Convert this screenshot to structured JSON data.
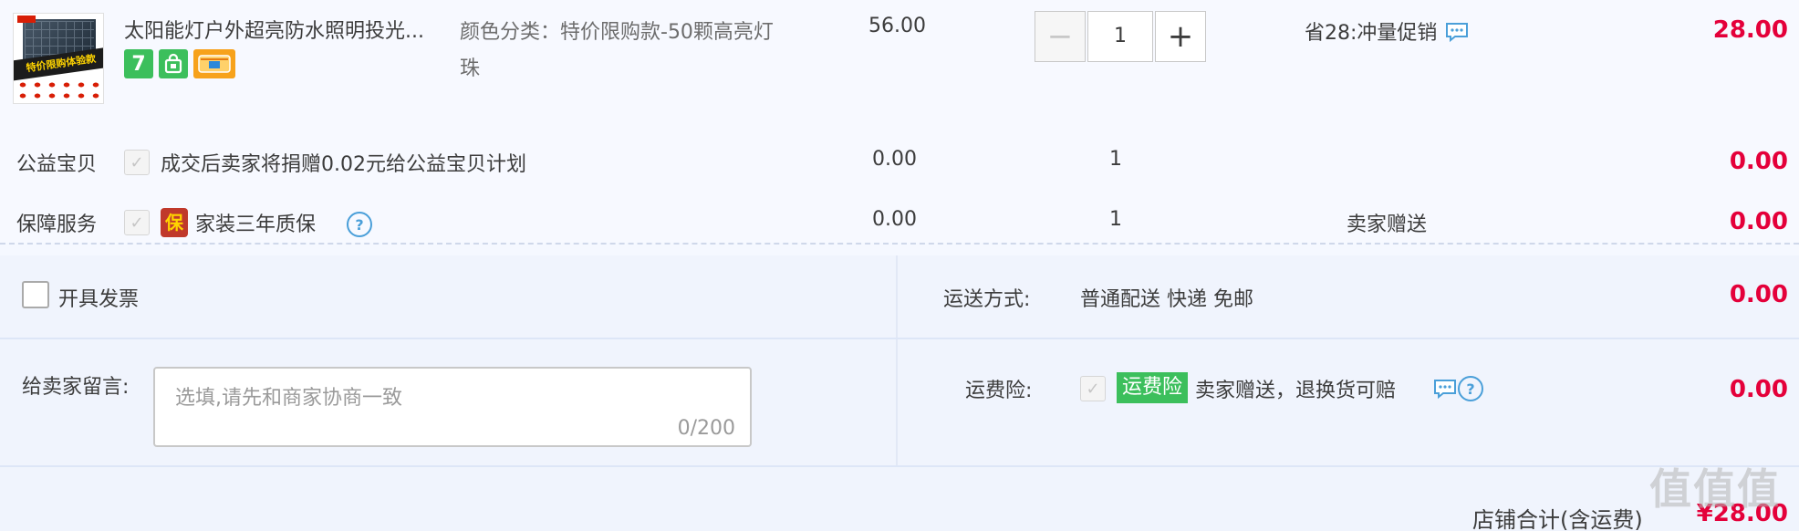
{
  "product": {
    "title": "太阳能灯户外超亮防水照明投光...",
    "image_banner": "特价限购体验款",
    "badge_7": "7",
    "sku": "颜色分类：特价限购款-50颗高亮灯珠",
    "unit_price": "56.00",
    "quantity": "1",
    "minus_label": "−",
    "plus_label": "+",
    "promo": "省28:冲量促销",
    "subtotal": "28.00"
  },
  "charity": {
    "label": "公益宝贝",
    "desc": "成交后卖家将捐赠0.02元给公益宝贝计划",
    "price": "0.00",
    "qty": "1",
    "total": "0.00"
  },
  "service": {
    "label": "保障服务",
    "badge": "保",
    "desc": "家装三年质保",
    "help": "?",
    "price": "0.00",
    "qty": "1",
    "gift": "卖家赠送",
    "total": "0.00"
  },
  "invoice": {
    "label": "开具发票"
  },
  "shipping": {
    "label": "运送方式:",
    "value": "普通配送 快递 免邮",
    "total": "0.00"
  },
  "memo": {
    "label": "给卖家留言:",
    "placeholder": "选填,请先和商家协商一致",
    "counter": "0/200"
  },
  "insurance": {
    "label": "运费险:",
    "tag": "运费险",
    "desc": "卖家赠送，退换货可赔",
    "help": "?",
    "total": "0.00"
  },
  "footer": {
    "label": "店铺合计(含运费)",
    "total": "¥28.00"
  },
  "watermark": "值值值"
}
